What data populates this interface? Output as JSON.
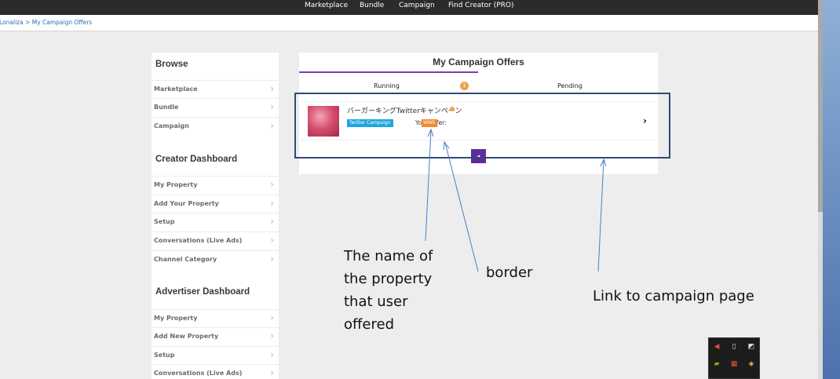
{
  "nav": {
    "items": [
      {
        "label": "Marketplace"
      },
      {
        "label": "Bundle"
      },
      {
        "label": "Campaign"
      },
      {
        "label": "Find Creator (PRO)"
      }
    ]
  },
  "breadcrumb": {
    "text": "Lonaliza > My Campaign Offers"
  },
  "sidebar": {
    "browse": {
      "title": "Browse",
      "items": [
        {
          "label": "Marketplace"
        },
        {
          "label": "Bundle"
        },
        {
          "label": "Campaign"
        }
      ]
    },
    "creator": {
      "title": "Creator Dashboard",
      "items": [
        {
          "label": "My Property"
        },
        {
          "label": "Add Your Property"
        },
        {
          "label": "Setup"
        },
        {
          "label": "Conversations (Live Ads)"
        },
        {
          "label": "Channel Category"
        }
      ]
    },
    "advertiser": {
      "title": "Advertiser Dashboard",
      "items": [
        {
          "label": "My Property"
        },
        {
          "label": "Add New Property"
        },
        {
          "label": "Setup"
        },
        {
          "label": "Conversations (Live Ads)"
        }
      ]
    },
    "chevron": "›"
  },
  "panel": {
    "title": "My Campaign Offers",
    "tabs": {
      "running": "Running",
      "running_count": "1",
      "pending": "Pending"
    },
    "offer": {
      "name": "バーガーキングTwitterキャンペーン",
      "tag": "Twitter Campaign",
      "your_offer_label": "Your Offer:",
      "offer_value": "WWE",
      "arrow": "›"
    },
    "pager_icon": "◂"
  },
  "annotations": {
    "name_note": "The name of the property that user offered",
    "border_note": "border",
    "link_note": "Link to campaign page",
    "highlight_color": "#2e4a78",
    "arrow_color": "#4a7fc1"
  },
  "tray": {
    "icons": [
      "speaker-icon",
      "usb-icon",
      "window-icon",
      "nvidia-icon",
      "network-icon",
      "shield-icon"
    ]
  },
  "colors": {
    "accent_purple": "#5b2d9c",
    "badge_orange": "#f0a050",
    "tag_blue": "#1fa6e0",
    "link_blue": "#2a6db5"
  }
}
